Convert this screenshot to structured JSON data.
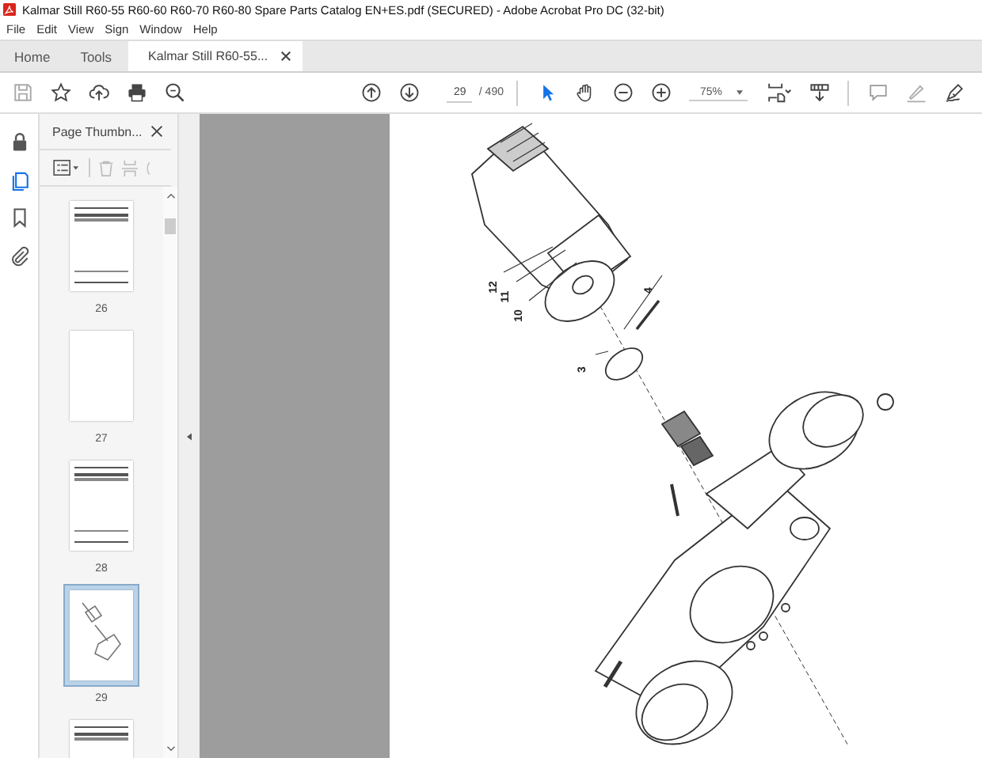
{
  "window": {
    "title": "Kalmar Still R60-55 R60-60 R60-70 R60-80 Spare Parts Catalog EN+ES.pdf (SECURED) - Adobe Acrobat Pro DC (32-bit)"
  },
  "menu": [
    "File",
    "Edit",
    "View",
    "Sign",
    "Window",
    "Help"
  ],
  "tabs": [
    {
      "label": "Home",
      "selected": false,
      "kind": "nav"
    },
    {
      "label": "Tools",
      "selected": false,
      "kind": "nav"
    },
    {
      "label": "Kalmar Still R60-55...",
      "selected": true,
      "kind": "document"
    }
  ],
  "toolbar": {
    "page": "29",
    "page_total": "/ 490",
    "zoom": "75%",
    "selection_tool_selected": true,
    "hand_tool_selected": false
  },
  "side_rail": [
    {
      "kind": "pages",
      "selected": true
    },
    {
      "kind": "bookmarks",
      "selected": false
    },
    {
      "kind": "attachments",
      "selected": false
    }
  ],
  "thumbnails_panel": {
    "title": "Page Thumbn...",
    "thumbnails": [
      {
        "label": "26",
        "kind": "table",
        "selected": false
      },
      {
        "label": "27",
        "kind": "blank",
        "selected": false
      },
      {
        "label": "28",
        "kind": "table",
        "selected": false
      },
      {
        "label": "29",
        "kind": "drawing",
        "selected": true
      },
      {
        "kind": "table",
        "selected": false
      }
    ]
  },
  "page": {
    "callouts": [
      {
        "label": "12"
      },
      {
        "label": "11"
      },
      {
        "label": "10"
      },
      {
        "label": "4"
      },
      {
        "label": "3"
      }
    ]
  }
}
